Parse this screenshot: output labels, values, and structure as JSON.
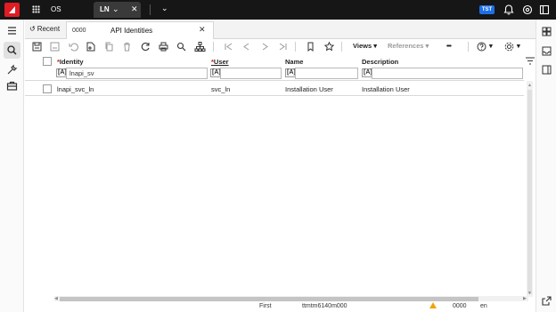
{
  "topbar": {
    "app_label": "OS",
    "tab_label": "LN",
    "env_badge": "TST",
    "icons": [
      "app-grid-icon",
      "chevron-down-icon",
      "close-icon",
      "bell-icon",
      "help-circle-icon",
      "user-avatar-icon"
    ]
  },
  "tabs": {
    "recent_label": "Recent",
    "session_code": "0000",
    "session_title": "API Identities"
  },
  "toolbar": {
    "views_label": "Views",
    "references_label": "References",
    "more_label": "•••"
  },
  "grid": {
    "columns": [
      {
        "label": "Identity",
        "required": true
      },
      {
        "label": "User",
        "required": true
      },
      {
        "label": "Name",
        "required": false
      },
      {
        "label": "Description",
        "required": false
      }
    ],
    "filter_symbol": "[A]",
    "filters": [
      "lnapi_sv",
      "",
      "",
      ""
    ],
    "rows": [
      {
        "identity": "lnapi_svc_ln",
        "user": "svc_ln",
        "name": "Installation User",
        "description": "Installation User"
      }
    ]
  },
  "status": {
    "position": "First",
    "session_id": "ttmtm6140m000",
    "company": "0000",
    "language": "en"
  },
  "colors": {
    "topbar_bg": "#161616",
    "brand_red": "#e01c25",
    "badge_blue": "#1d6fe8",
    "required_red": "#d01818",
    "warning": "#f0a30a"
  }
}
